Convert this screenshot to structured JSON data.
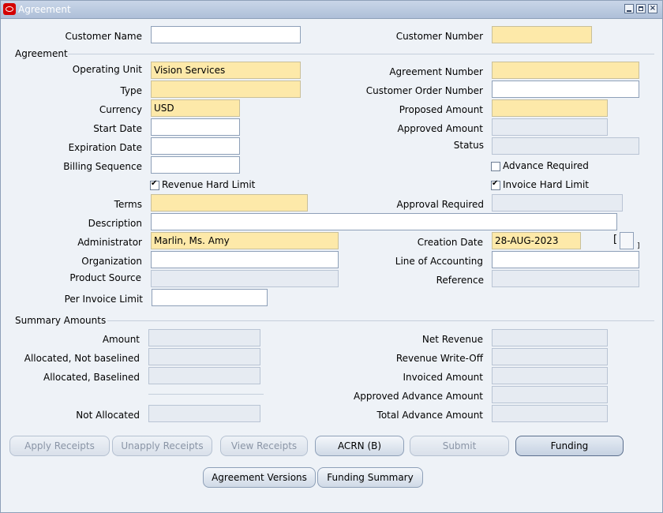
{
  "window": {
    "title": "Agreement",
    "minimize_icon": "minimize-icon",
    "maximize_icon": "maximize-icon",
    "close_icon": "close-icon"
  },
  "header": {
    "customer_name_label": "Customer Name",
    "customer_name_value": "",
    "customer_number_label": "Customer Number",
    "customer_number_value": ""
  },
  "agreement": {
    "section_label": "Agreement",
    "operating_unit_label": "Operating Unit",
    "operating_unit_value": "Vision Services",
    "type_label": "Type",
    "type_value": "",
    "currency_label": "Currency",
    "currency_value": "USD",
    "start_date_label": "Start Date",
    "start_date_value": "",
    "expiration_date_label": "Expiration Date",
    "expiration_date_value": "",
    "billing_sequence_label": "Billing Sequence",
    "billing_sequence_value": "",
    "revenue_hard_limit_label": "Revenue Hard Limit",
    "revenue_hard_limit_checked": true,
    "terms_label": "Terms",
    "terms_value": "",
    "description_label": "Description",
    "description_value": "",
    "administrator_label": "Administrator",
    "administrator_value": "Marlin, Ms. Amy",
    "organization_label": "Organization",
    "organization_value": "",
    "product_source_label": "Product Source",
    "product_source_value": "",
    "per_invoice_limit_label": "Per Invoice Limit",
    "per_invoice_limit_value": "",
    "agreement_number_label": "Agreement Number",
    "agreement_number_value": "",
    "customer_order_number_label": "Customer Order Number",
    "customer_order_number_value": "",
    "proposed_amount_label": "Proposed Amount",
    "proposed_amount_value": "",
    "approved_amount_label": "Approved Amount",
    "approved_amount_value": "",
    "status_label": "Status",
    "status_value": "",
    "advance_required_label": "Advance Required",
    "advance_required_checked": false,
    "invoice_hard_limit_label": "Invoice Hard Limit",
    "invoice_hard_limit_checked": true,
    "approval_required_label": "Approval Required",
    "approval_required_value": "",
    "creation_date_label": "Creation Date",
    "creation_date_value": "28-AUG-2023",
    "line_of_accounting_label": "Line of Accounting",
    "line_of_accounting_value": "",
    "reference_label": "Reference",
    "reference_value": "",
    "flex_open": "[",
    "flex_close": "]"
  },
  "summary": {
    "section_label": "Summary Amounts",
    "amount_label": "Amount",
    "amount_value": "",
    "allocated_not_baselined_label": "Allocated, Not baselined",
    "allocated_not_baselined_value": "",
    "allocated_baselined_label": "Allocated, Baselined",
    "allocated_baselined_value": "",
    "not_allocated_label": "Not Allocated",
    "not_allocated_value": "",
    "net_revenue_label": "Net Revenue",
    "net_revenue_value": "",
    "revenue_write_off_label": "Revenue Write-Off",
    "revenue_write_off_value": "",
    "invoiced_amount_label": "Invoiced Amount",
    "invoiced_amount_value": "",
    "approved_advance_amount_label": "Approved Advance Amount",
    "approved_advance_amount_value": "",
    "total_advance_amount_label": "Total Advance Amount",
    "total_advance_amount_value": ""
  },
  "buttons": {
    "apply_receipts": "Apply Receipts",
    "unapply_receipts": "Unapply Receipts",
    "view_receipts": "View Receipts",
    "acrn": "ACRN (B)",
    "submit": "Submit",
    "funding": "Funding",
    "agreement_versions": "Agreement  Versions",
    "funding_summary": "Funding Summary"
  }
}
